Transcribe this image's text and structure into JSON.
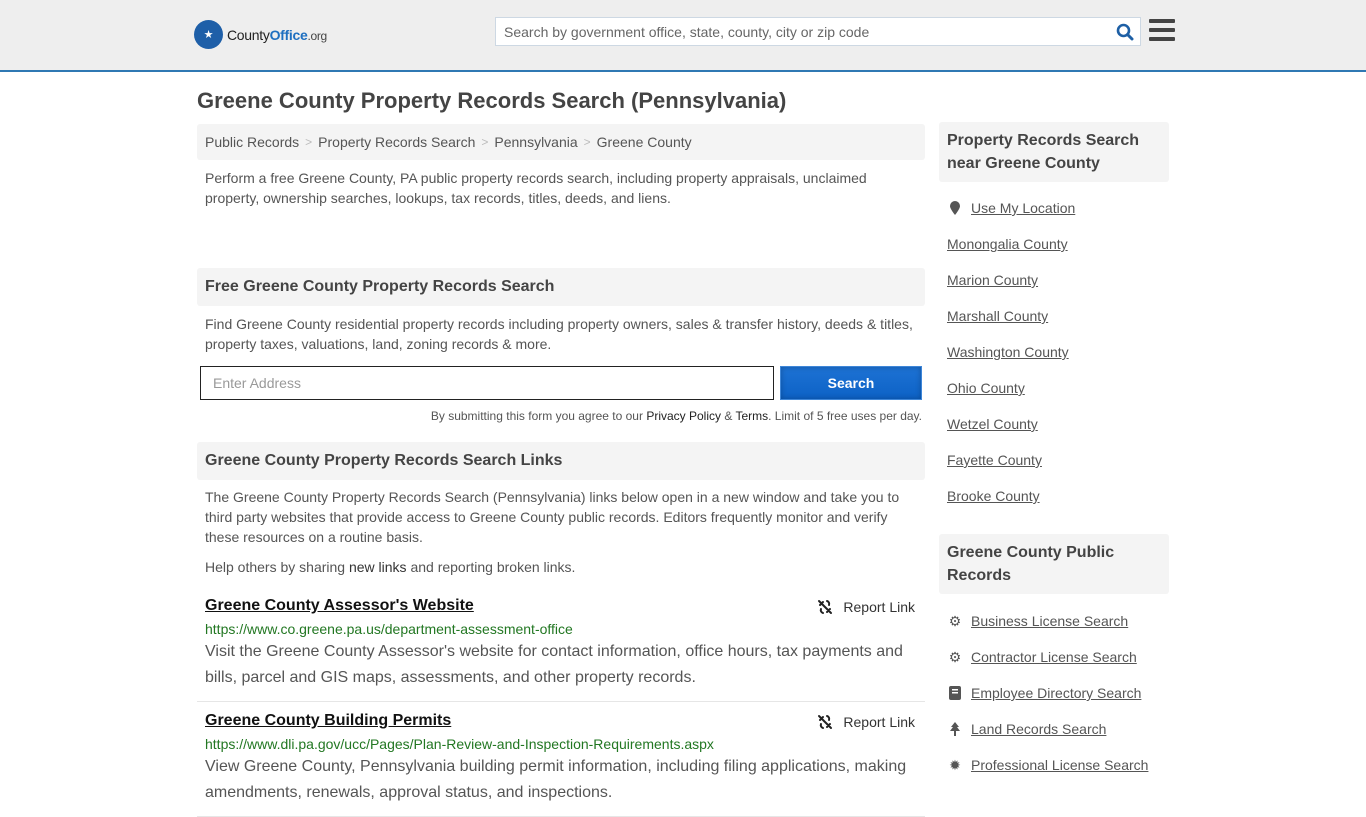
{
  "header": {
    "logo_text_a": "County",
    "logo_text_b": "Office",
    "logo_text_c": ".org",
    "search_placeholder": "Search by government office, state, county, city or zip code"
  },
  "page_title": "Greene County Property Records Search (Pennsylvania)",
  "breadcrumb": [
    "Public Records",
    "Property Records Search",
    "Pennsylvania",
    "Greene County"
  ],
  "intro": "Perform a free Greene County, PA public property records search, including property appraisals, unclaimed property, ownership searches, lookups, tax records, titles, deeds, and liens.",
  "free_search": {
    "heading": "Free Greene County Property Records Search",
    "text": "Find Greene County residential property records including property owners, sales & transfer history, deeds & titles, property taxes, valuations, land, zoning records & more.",
    "placeholder": "Enter Address",
    "button": "Search",
    "fine_a": "By submitting this form you agree to our ",
    "privacy": "Privacy Policy",
    "amp": " & ",
    "terms": "Terms",
    "fine_b": ". Limit of 5 free uses per day."
  },
  "links_section": {
    "heading": "Greene County Property Records Search Links",
    "text": "The Greene County Property Records Search (Pennsylvania) links below open in a new window and take you to third party websites that provide access to Greene County public records. Editors frequently monitor and verify these resources on a routine basis.",
    "help_a": "Help others by sharing ",
    "help_link": "new links",
    "help_b": " and reporting broken links.",
    "report_label": "Report Link",
    "entries": [
      {
        "title": "Greene County Assessor's Website",
        "url": "https://www.co.greene.pa.us/department-assessment-office",
        "desc": "Visit the Greene County Assessor's website for contact information, office hours, tax payments and bills, parcel and GIS maps, assessments, and other property records."
      },
      {
        "title": "Greene County Building Permits",
        "url": "https://www.dli.pa.gov/ucc/Pages/Plan-Review-and-Inspection-Requirements.aspx",
        "desc": "View Greene County, Pennsylvania building permit information, including filing applications, making amendments, renewals, approval status, and inspections."
      }
    ]
  },
  "sidebar": {
    "nearby_heading": "Property Records Search near Greene County",
    "use_location": "Use My Location",
    "nearby": [
      "Monongalia County",
      "Marion County",
      "Marshall County",
      "Washington County",
      "Ohio County",
      "Wetzel County",
      "Fayette County",
      "Brooke County"
    ],
    "public_heading": "Greene County Public Records",
    "public": [
      {
        "icon": "gears-icon",
        "label": "Business License Search"
      },
      {
        "icon": "gear-icon",
        "label": "Contractor License Search"
      },
      {
        "icon": "book-icon",
        "label": "Employee Directory Search"
      },
      {
        "icon": "tree-icon",
        "label": "Land Records Search"
      },
      {
        "icon": "badge-icon",
        "label": "Professional License Search"
      }
    ]
  }
}
